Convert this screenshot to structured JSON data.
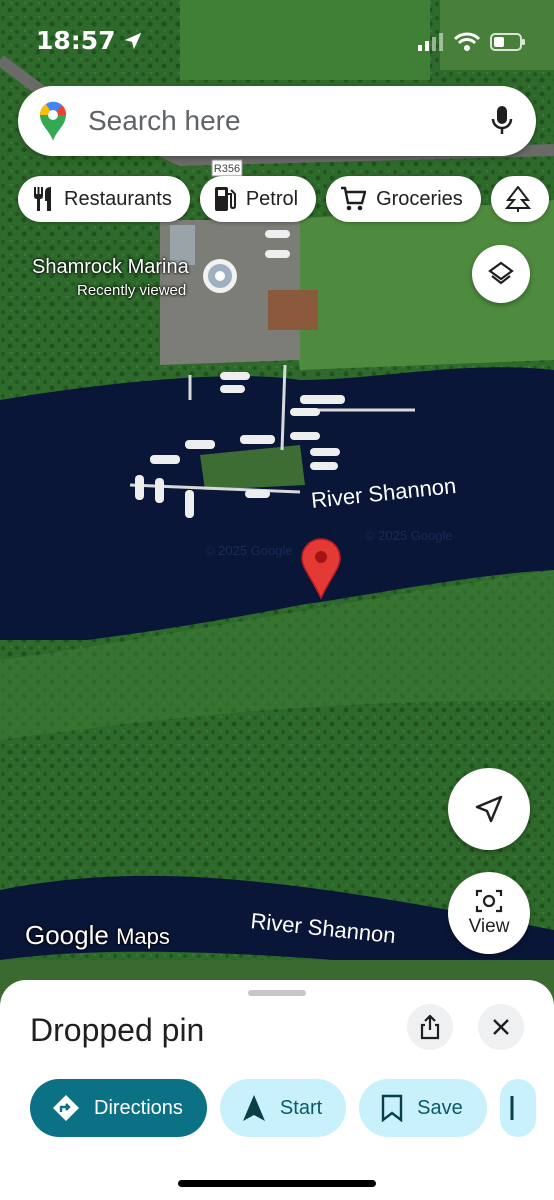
{
  "status_bar": {
    "time": "18:57"
  },
  "search": {
    "placeholder": "Search here"
  },
  "chips": [
    {
      "label": "Restaurants",
      "icon": "fork-knife-icon"
    },
    {
      "label": "Petrol",
      "icon": "fuel-pump-icon"
    },
    {
      "label": "Groceries",
      "icon": "shopping-cart-icon"
    }
  ],
  "map": {
    "road_label": "R356",
    "marina_name": "Shamrock Marina",
    "marina_sub": "Recently viewed",
    "river_label_1": "River Shannon",
    "river_label_2": "River Shannon",
    "watermark_1": "© 2025 Google",
    "watermark_2": "© 2025 Google",
    "google_word": "Google",
    "maps_word": "Maps",
    "view_label": "View"
  },
  "sheet": {
    "title": "Dropped pin",
    "actions": [
      {
        "label": "Directions",
        "icon": "directions-icon"
      },
      {
        "label": "Start",
        "icon": "navigation-arrow-icon"
      },
      {
        "label": "Save",
        "icon": "bookmark-icon"
      }
    ]
  },
  "colors": {
    "accent": "#0b7285",
    "water": "#0a1638",
    "grass": "#2f6b2c",
    "pin": "#e53935"
  }
}
